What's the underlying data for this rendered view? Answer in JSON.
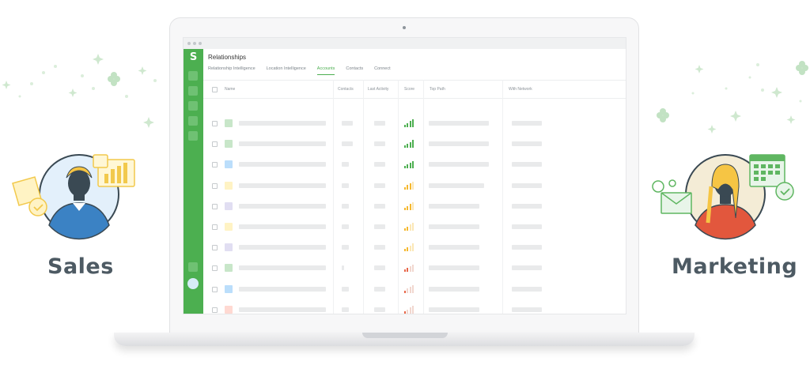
{
  "labels": {
    "left": "Sales",
    "right": "Marketing"
  },
  "app": {
    "title": "Relationships",
    "logo": "S",
    "tabs": [
      {
        "label": "Relationship Intelligence",
        "active": false
      },
      {
        "label": "Location Intelligence",
        "active": false
      },
      {
        "label": "Accounts",
        "active": true
      },
      {
        "label": "Contacts",
        "active": false
      },
      {
        "label": "Connect",
        "active": false
      }
    ],
    "columns": {
      "name": "Name",
      "contacts": "Contacts",
      "last_activity": "Last Activity",
      "score": "Score",
      "top_path": "Top Path",
      "with_network": "With Network"
    },
    "rows": [
      {
        "avatar_color": "#c8e6c9",
        "score": 4,
        "score_color": "#4caf50"
      },
      {
        "avatar_color": "#c8e6c9",
        "score": 4,
        "score_color": "#4caf50"
      },
      {
        "avatar_color": "#bbdefb",
        "score": 4,
        "score_color": "#4caf50"
      },
      {
        "avatar_color": "#fff3c4",
        "score": 3,
        "score_color": "#f5b82e"
      },
      {
        "avatar_color": "#e1def2",
        "score": 3,
        "score_color": "#f5b82e"
      },
      {
        "avatar_color": "#fff3c4",
        "score": 2,
        "score_color": "#f5b82e"
      },
      {
        "avatar_color": "#e1def2",
        "score": 2,
        "score_color": "#f5b82e"
      },
      {
        "avatar_color": "#c8e6c9",
        "score": 2,
        "score_color": "#e8674a"
      },
      {
        "avatar_color": "#bbdefb",
        "score": 1,
        "score_color": "#e8674a"
      },
      {
        "avatar_color": "#ffd9d2",
        "score": 1,
        "score_color": "#e8674a"
      }
    ]
  },
  "colors": {
    "brand_green": "#4caf50",
    "label_gray": "#4d5a63"
  }
}
